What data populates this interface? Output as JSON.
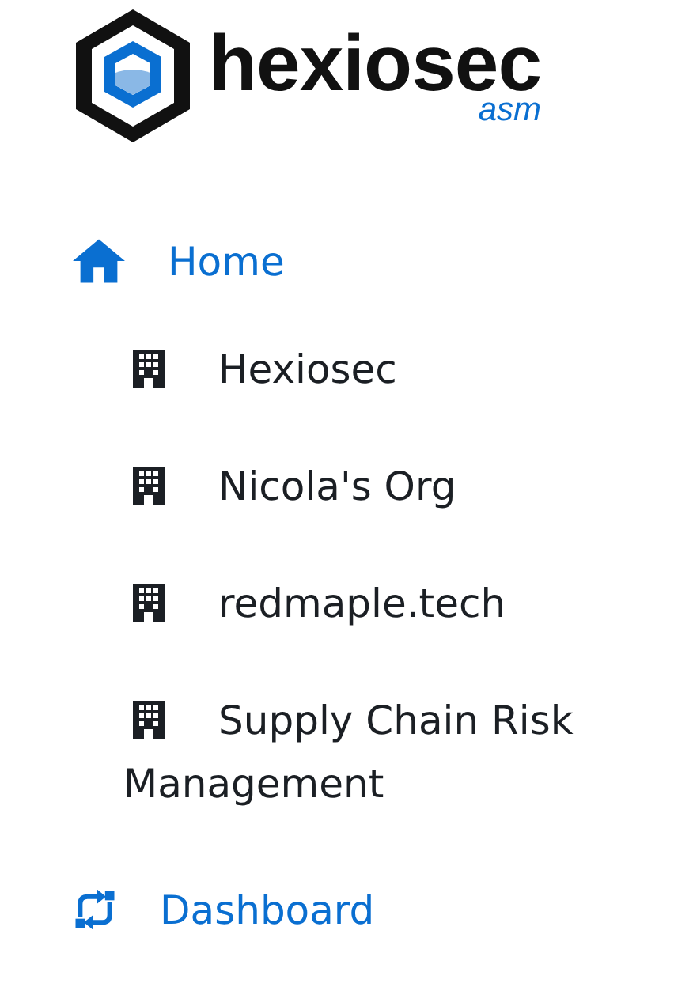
{
  "logo": {
    "name": "hexiosec",
    "product": "asm"
  },
  "nav": [
    {
      "label": "Home",
      "kind": "home",
      "children": [
        {
          "label": "Hexiosec",
          "kind": "org"
        },
        {
          "label": "Nicola's Org",
          "kind": "org"
        },
        {
          "label": "redmaple.tech",
          "kind": "org"
        },
        {
          "label": "Supply Chain Risk Management",
          "kind": "org"
        }
      ]
    },
    {
      "label": "Dashboard",
      "kind": "dashboard"
    }
  ]
}
